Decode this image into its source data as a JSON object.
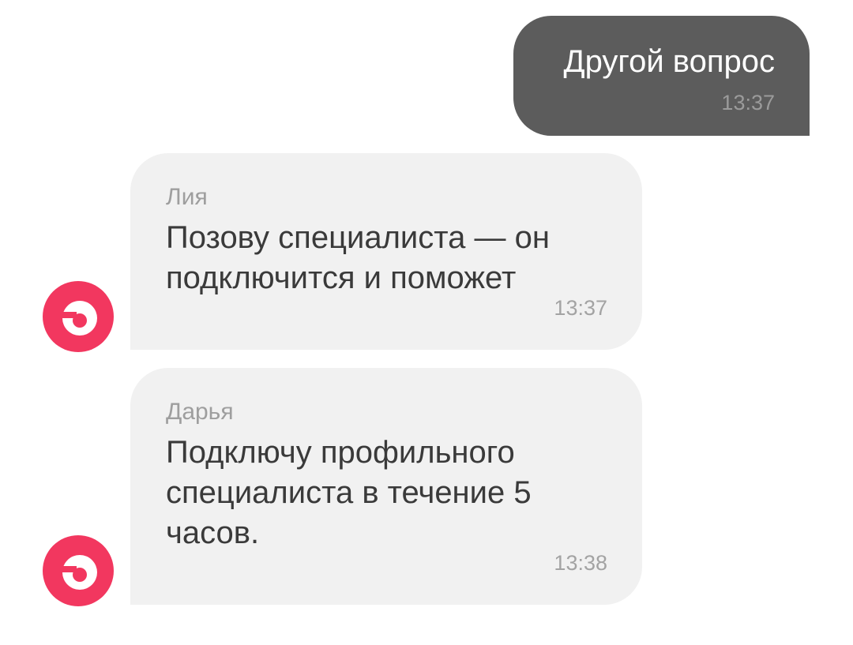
{
  "messages": [
    {
      "direction": "outgoing",
      "text": "Другой вопрос",
      "time": "13:37"
    },
    {
      "direction": "incoming",
      "sender": "Лия",
      "text": "Позову специалиста — он подключится и поможет",
      "time": "13:37",
      "avatar_icon": "brand-logo-icon"
    },
    {
      "direction": "incoming",
      "sender": "Дарья",
      "text": "Подключу профильного специалиста в течение 5 часов.",
      "time": "13:38",
      "avatar_icon": "brand-logo-icon"
    }
  ],
  "colors": {
    "outgoing_bubble": "#5c5c5c",
    "incoming_bubble": "#f1f1f1",
    "avatar_accent": "#f2375f",
    "background": "#ffffff"
  }
}
